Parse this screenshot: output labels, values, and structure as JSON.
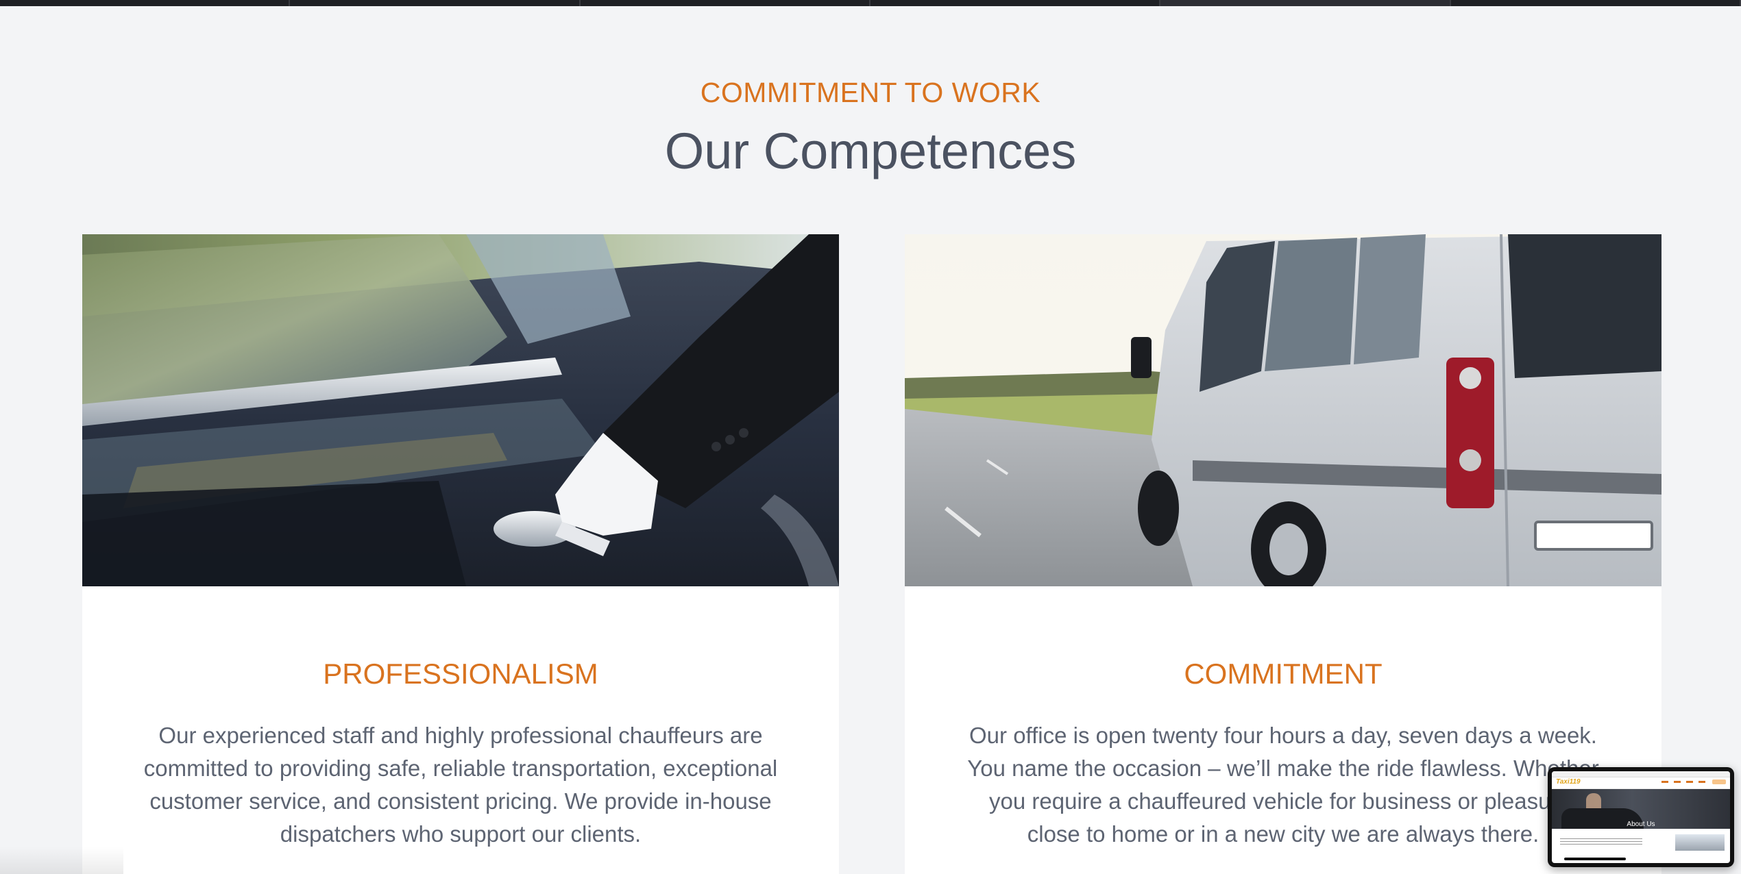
{
  "section": {
    "eyebrow": "COMMITMENT TO WORK",
    "heading": "Our Competences"
  },
  "cards": [
    {
      "title": "PROFESSIONALISM",
      "text": "Our experienced staff and highly professional chauffeurs are committed to providing safe, reliable transportation, exceptional customer service, and consistent pricing. We provide in-house dispatchers who support our clients.",
      "image": "chauffeur-opening-car-door"
    },
    {
      "title": "COMMITMENT",
      "text": "Our office is open twenty four hours a day, seven days a week. You name the occasion – we’ll make the ride flawless. Whether you require a chauffeured vehicle for business or pleasure, close to home or in a new city we are always there.",
      "image": "silver-van-on-road"
    }
  ],
  "preview": {
    "logo": "Taxi119",
    "hero_title": "About Us"
  },
  "colors": {
    "accent": "#d9731f",
    "heading": "#4b5261",
    "body_text": "#5d6472",
    "background": "#f3f4f6"
  }
}
